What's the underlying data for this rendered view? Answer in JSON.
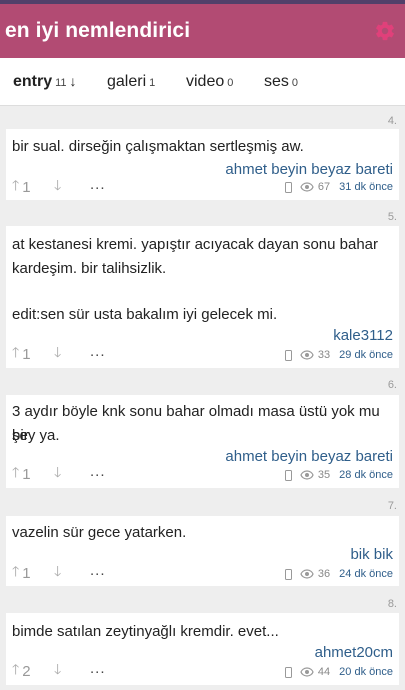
{
  "header": {
    "title": "en iyi nemlendirici"
  },
  "tabs": [
    {
      "label": "entry",
      "count": "11",
      "sort_icon": "arrow-down-icon"
    },
    {
      "label": "galeri",
      "count": "1"
    },
    {
      "label": "video",
      "count": "0"
    },
    {
      "label": "ses",
      "count": "0"
    }
  ],
  "entries": [
    {
      "number": "4.",
      "text": "bir sual. dirseğin çalışmaktan sertleşmiş aw.",
      "author": "ahmet beyin beyaz bareti",
      "votes": "1",
      "views": "67",
      "time": "31 dk önce"
    },
    {
      "number": "5.",
      "text_line1": "at kestanesi kremi. yapıştır acıyacak dayan sonu bahar",
      "text_line2": "kardeşim. bir talihsizlik.",
      "text_line3": "edit:sen sür usta bakalım iyi gelecek mi.",
      "author": "kale3112",
      "votes": "1",
      "views": "33",
      "time": "29 dk önce"
    },
    {
      "number": "6.",
      "text_line1": "3 aydır böyle knk sonu bahar olmadı masa üstü yok mu bir",
      "text_line2": "şey ya.",
      "author": "ahmet beyin beyaz bareti",
      "votes": "1",
      "views": "35",
      "time": "28 dk önce"
    },
    {
      "number": "7.",
      "text": "vazelin sür gece yatarken.",
      "author": "bik bik",
      "votes": "1",
      "views": "36",
      "time": "24 dk önce"
    },
    {
      "number": "8.",
      "text": "bimde satılan zeytinyağlı kremdir. evet...",
      "author": "ahmet20cm",
      "votes": "2",
      "views": "44",
      "time": "20 dk önce"
    }
  ],
  "more_label": "...",
  "colors": {
    "header_bg": "#b24b73",
    "accent_gear": "#e0407a",
    "link": "#2f5e8a"
  }
}
